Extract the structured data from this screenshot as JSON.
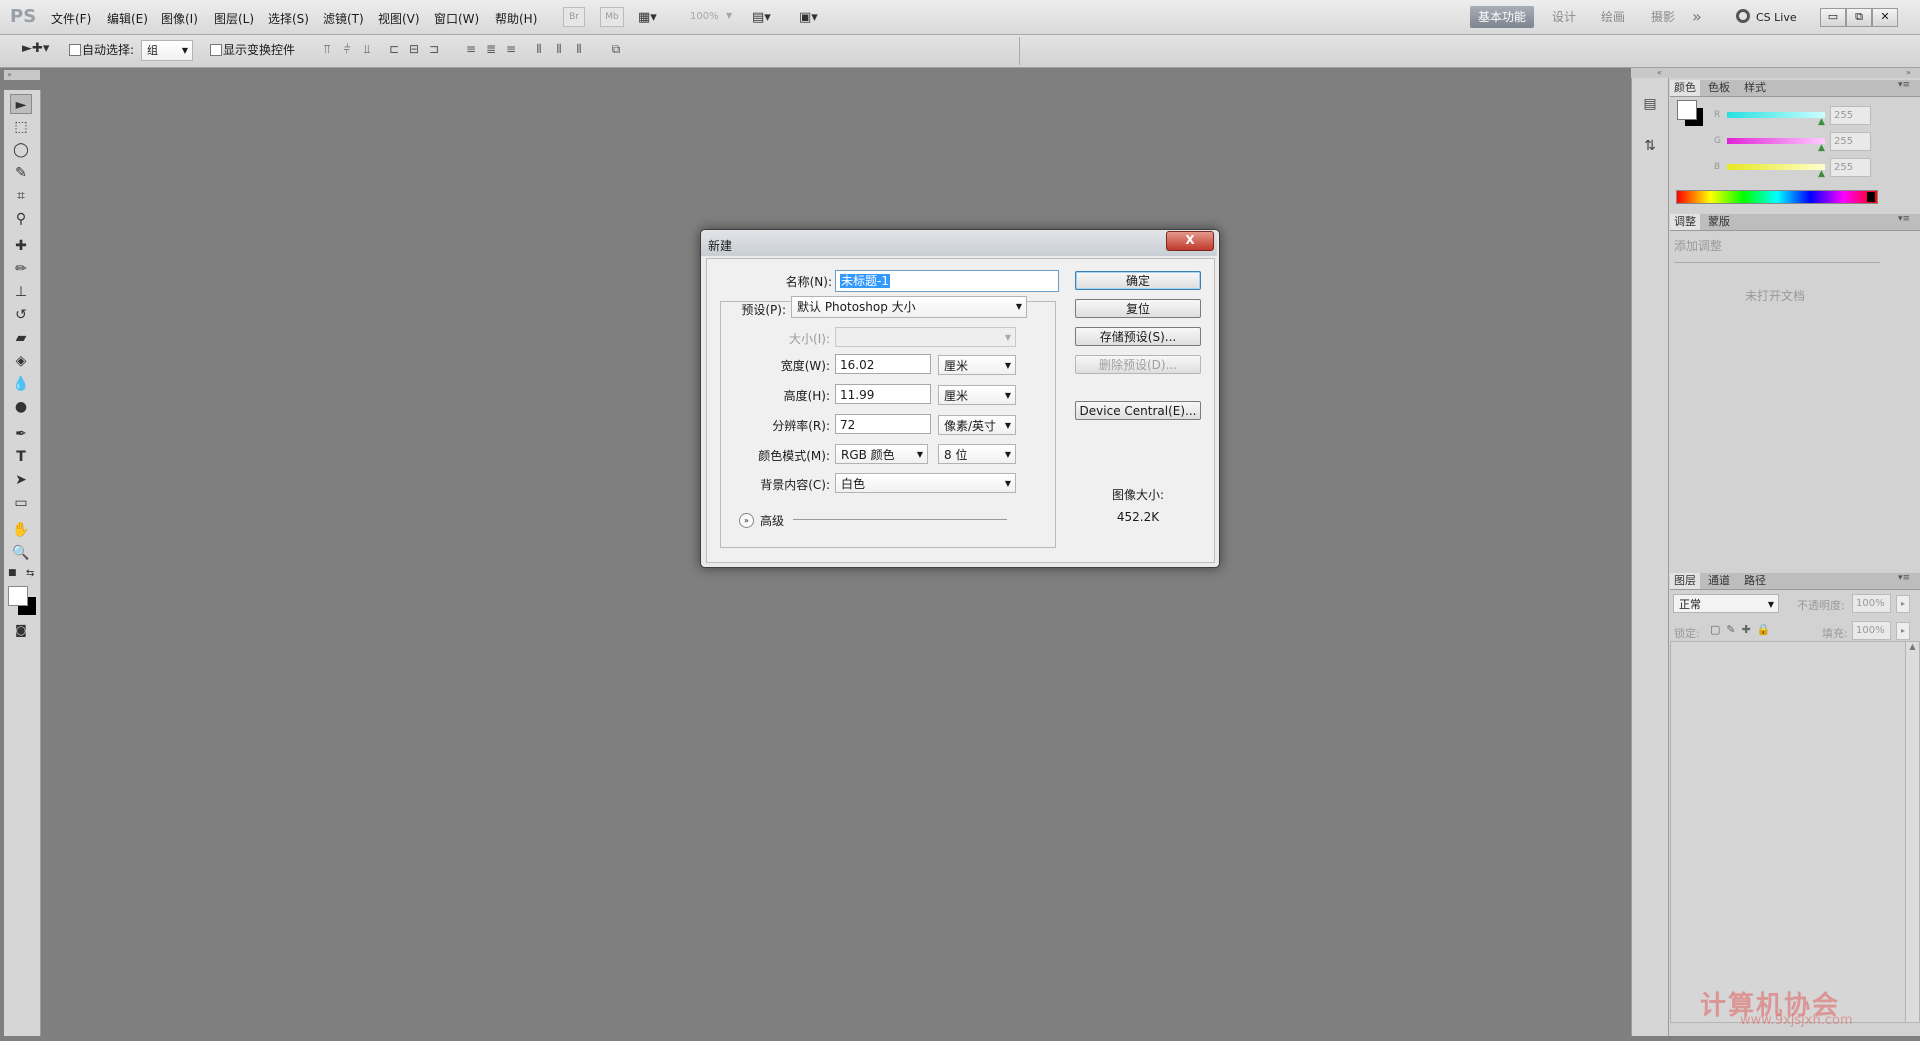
{
  "menubar": {
    "logo": "PS",
    "items": [
      "文件(F)",
      "编辑(E)",
      "图像(I)",
      "图层(L)",
      "选择(S)",
      "滤镜(T)",
      "视图(V)",
      "窗口(W)",
      "帮助(H)"
    ],
    "bridge_label": "Br",
    "mini_bridge_label": "Mb",
    "zoom": "100%",
    "workspaces": [
      "基本功能",
      "设计",
      "绘画",
      "摄影"
    ],
    "more": "»",
    "cs_live": "CS Live",
    "window_controls": [
      "▭",
      "⧉",
      "✕"
    ]
  },
  "options_bar": {
    "auto_select_label": "自动选择:",
    "auto_select_value": "组",
    "show_transform_label": "显示变换控件"
  },
  "color_panel": {
    "tabs": [
      "颜色",
      "色板",
      "样式"
    ],
    "labels": [
      "R",
      "G",
      "B"
    ],
    "values": [
      "255",
      "255",
      "255"
    ],
    "colors": {
      "r_track": "#33d6d6",
      "g_track": "#e64ad6",
      "b_track": "#e6e633"
    }
  },
  "adjust_panel": {
    "tabs": [
      "调整",
      "蒙版"
    ],
    "add_label": "添加调整",
    "empty_text": "未打开文档"
  },
  "layers_panel": {
    "tabs": [
      "图层",
      "通道",
      "路径"
    ],
    "blend_mode": "正常",
    "opacity_label": "不透明度:",
    "opacity_value": "100%",
    "lock_label": "锁定:",
    "fill_label": "填充:",
    "fill_value": "100%"
  },
  "dialog": {
    "title": "新建",
    "close": "X",
    "name_label": "名称(N):",
    "name_value": "未标题-1",
    "preset_label": "预设(P):",
    "preset_value": "默认 Photoshop 大小",
    "size_label": "大小(I):",
    "width_label": "宽度(W):",
    "width_value": "16.02",
    "width_unit": "厘米",
    "height_label": "高度(H):",
    "height_value": "11.99",
    "height_unit": "厘米",
    "resolution_label": "分辨率(R):",
    "resolution_value": "72",
    "resolution_unit": "像素/英寸",
    "color_mode_label": "颜色模式(M):",
    "color_mode_value": "RGB 颜色",
    "bit_depth_value": "8 位",
    "background_label": "背景内容(C):",
    "background_value": "白色",
    "advanced_label": "高级",
    "ok": "确定",
    "reset": "复位",
    "save_preset": "存储预设(S)...",
    "delete_preset": "删除预设(D)...",
    "device_central": "Device Central(E)...",
    "image_size_label": "图像大小:",
    "image_size_value": "452.2K"
  },
  "watermark": {
    "text": "计算机协会",
    "url": "www.9xjsjxh.com"
  }
}
